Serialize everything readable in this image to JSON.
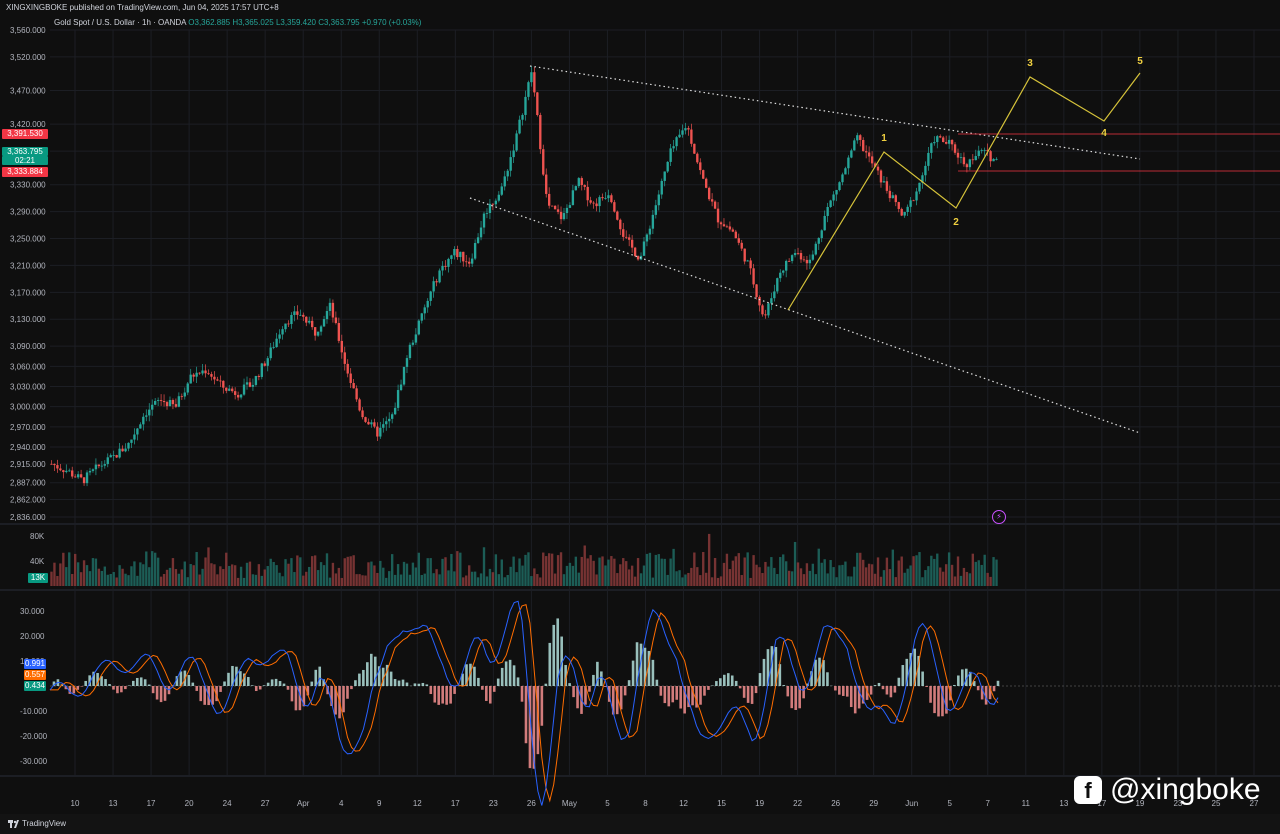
{
  "header": {
    "publisher": "XINGXINGBOKE published on TradingView.com, Jun 04, 2025 17:57 UTC+8"
  },
  "legend": {
    "symbol": "Gold Spot / U.S. Dollar · 1h · OANDA",
    "o": "O3,362.885",
    "h": "H3,365.025",
    "l": "L3,359.420",
    "c": "C3,363.795",
    "chg": "+0.970 (+0.03%)"
  },
  "price_tags": {
    "top": "3,391.530",
    "current": "3,363.795",
    "current_sub": "02:21",
    "bottom": "3,333.884",
    "colors": {
      "red": "#f23645",
      "green": "#089981"
    }
  },
  "volume": {
    "labels": [
      "80K",
      "40K"
    ],
    "current": "13K"
  },
  "oscillator": {
    "labels": [
      "30.000",
      "20.000",
      "10.000",
      "-10.000",
      "-20.000",
      "-30.000"
    ],
    "values": [
      "0.991",
      "0.557",
      "0.434"
    ],
    "colors": [
      "#2962ff",
      "#ff6d00",
      "#26a69a"
    ]
  },
  "watermark": {
    "icon": "facebook-icon",
    "text": "@xingboke"
  },
  "footer": {
    "brand": "TradingView"
  },
  "chart_data": {
    "type": "line",
    "title": "Gold Spot / U.S. Dollar · 1h · OANDA",
    "y_ticks": [
      "3,560.000",
      "3,520.000",
      "3,470.000",
      "3,420.000",
      "3,380.000",
      "3,330.000",
      "3,290.000",
      "3,250.000",
      "3,210.000",
      "3,170.000",
      "3,130.000",
      "3,090.000",
      "3,060.000",
      "3,030.000",
      "3,000.000",
      "2,970.000",
      "2,940.000",
      "2,915.000",
      "2,887.000",
      "2,862.000",
      "2,836.000"
    ],
    "x_ticks": [
      "10",
      "13",
      "17",
      "20",
      "24",
      "27",
      "Apr",
      "4",
      "9",
      "12",
      "17",
      "23",
      "26",
      "May",
      "5",
      "8",
      "12",
      "15",
      "19",
      "22",
      "26",
      "29",
      "Jun",
      "5",
      "7",
      "11",
      "13",
      "17",
      "19",
      "23",
      "25",
      "27"
    ],
    "ylim": [
      2836,
      3560
    ],
    "series": [
      {
        "values": [
          2915,
          2905,
          2890,
          2910,
          2925,
          2945,
          2990,
          3010,
          3000,
          3045,
          3055,
          3030,
          3020,
          3035,
          3075,
          3125,
          3140,
          3110,
          3150,
          3060,
          2990,
          2960,
          2985,
          3080,
          3140,
          3200,
          3230,
          3215,
          3290,
          3320,
          3400,
          3500,
          3300,
          3280,
          3335,
          3300,
          3320,
          3250,
          3220,
          3300,
          3380,
          3420,
          3340,
          3280,
          3260,
          3210,
          3130,
          3200,
          3230,
          3215,
          3290,
          3340,
          3400,
          3360,
          3320,
          3280,
          3330,
          3400,
          3390,
          3360,
          3380,
          3366
        ],
        "wave_labels": [
          "1",
          "2",
          "3",
          "4",
          "5"
        ]
      }
    ],
    "wave_points": {
      "1": 3400,
      "2": 3290,
      "3": 3480,
      "4": 3420,
      "5": 3490
    },
    "grid": true,
    "legend": "top-left"
  }
}
